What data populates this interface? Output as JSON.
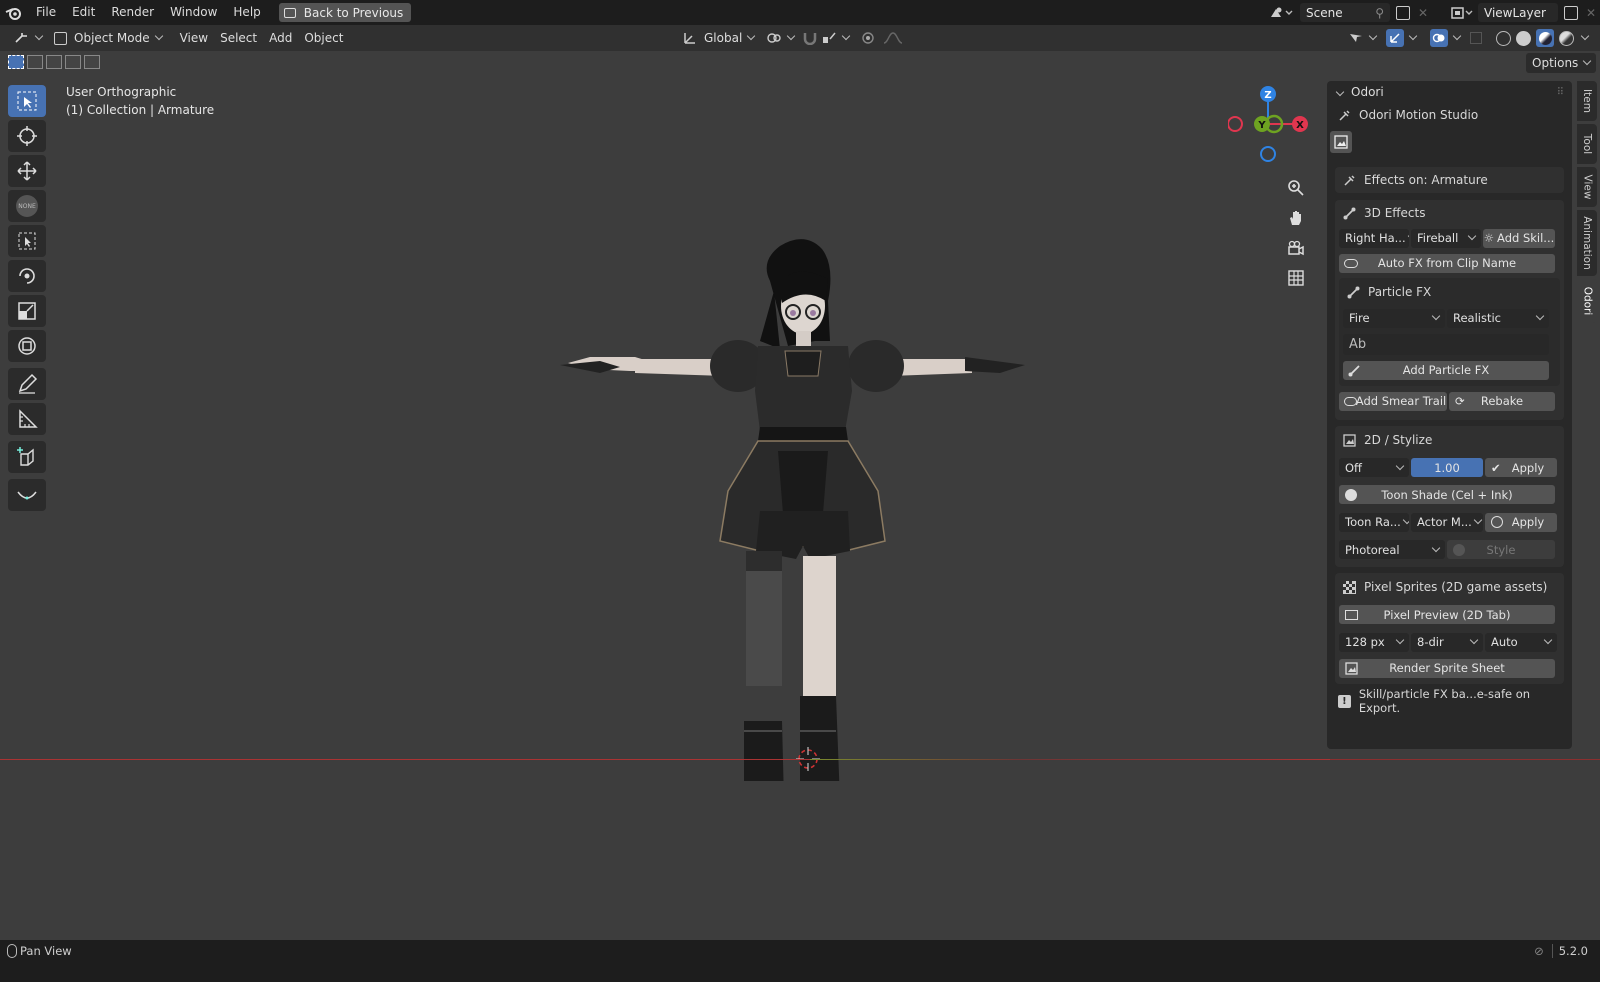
{
  "menu": {
    "file": "File",
    "edit": "Edit",
    "render": "Render",
    "window": "Window",
    "help": "Help",
    "back": "Back to Previous"
  },
  "scene": {
    "name": "Scene",
    "view_layer": "ViewLayer"
  },
  "header": {
    "mode": "Object Mode",
    "view": "View",
    "select": "Select",
    "add": "Add",
    "object": "Object",
    "transform": "Global"
  },
  "options": "Options",
  "viewport": {
    "view_name": "User Orthographic",
    "collection": "(1) Collection | Armature"
  },
  "gizmo": {
    "z": "Z",
    "y": "Y",
    "x": "X"
  },
  "panel": {
    "title": "Odori",
    "studio": "Odori Motion Studio",
    "effects_on": "Effects on: Armature",
    "fx3d": {
      "title": "3D Effects",
      "hand": "Right Ha...",
      "effect": "Fireball",
      "add_skill": "Add Skil...",
      "auto_fx": "Auto FX from Clip Name"
    },
    "particle": {
      "title": "Particle FX",
      "type": "Fire",
      "style": "Realistic",
      "name_placeholder": "Ab",
      "add": "Add Particle FX"
    },
    "smear": "Add Smear Trail",
    "rebake": "Rebake",
    "stylize": {
      "title": "2D / Stylize",
      "mode": "Off",
      "amount": "1.00",
      "apply": "Apply",
      "toon": "Toon Shade (Cel + Ink)",
      "toon_ramp": "Toon Ra...",
      "actor": "Actor M...",
      "apply2": "Apply",
      "look": "Photoreal",
      "style": "Style"
    },
    "sprites": {
      "title": "Pixel Sprites (2D game assets)",
      "preview": "Pixel Preview (2D Tab)",
      "size": "128 px",
      "dirs": "8-dir",
      "auto": "Auto",
      "render": "Render Sprite Sheet"
    },
    "note": "Skill/particle FX ba...e-safe on Export."
  },
  "side_tabs": [
    "Item",
    "Tool",
    "View",
    "Animation",
    "Odori"
  ],
  "status": {
    "left": "Pan View",
    "version": "5.2.0"
  },
  "colors": {
    "accent": "#4772b3",
    "axis_x": "#e0364f",
    "axis_y": "#6ea321",
    "axis_z": "#2f83e3"
  }
}
